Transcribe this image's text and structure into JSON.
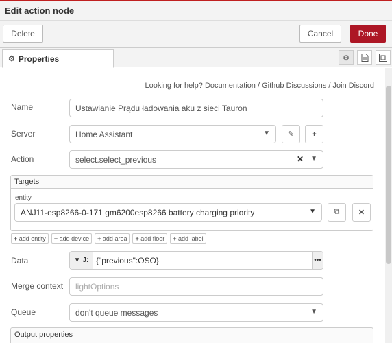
{
  "header": {
    "title": "Edit action node"
  },
  "toolbar": {
    "delete_label": "Delete",
    "cancel_label": "Cancel",
    "done_label": "Done"
  },
  "tabs": {
    "properties_label": "Properties",
    "settings_icon": "gear-icon",
    "description_icon": "document-icon",
    "appearance_icon": "frame-icon"
  },
  "help": {
    "prefix": "Looking for help?",
    "documentation": "Documentation",
    "sep1": "/",
    "github": "Github Discussions",
    "sep2": "/",
    "discord": "Join Discord"
  },
  "form": {
    "name_label": "Name",
    "name_value": "Ustawianie Prądu ładowania aku z sieci Tauron",
    "server_label": "Server",
    "server_value": "Home Assistant",
    "action_label": "Action",
    "action_value": "select.select_previous",
    "targets_header": "Targets",
    "entity_label": "entity",
    "entity_value": "ANJ11-esp8266-0-171 gm6200esp8266 battery charging priority",
    "chips": [
      "add entity",
      "add device",
      "add area",
      "add floor",
      "add label"
    ],
    "data_label": "Data",
    "data_type_glyph": "J:",
    "data_value": "{\"previous\":OSO}",
    "merge_label": "Merge context",
    "merge_placeholder": "lightOptions",
    "queue_label": "Queue",
    "queue_value": "don't queue messages",
    "output_header": "Output properties"
  },
  "colors": {
    "done_bg": "#ad1625",
    "top_accent": "#c02020"
  }
}
